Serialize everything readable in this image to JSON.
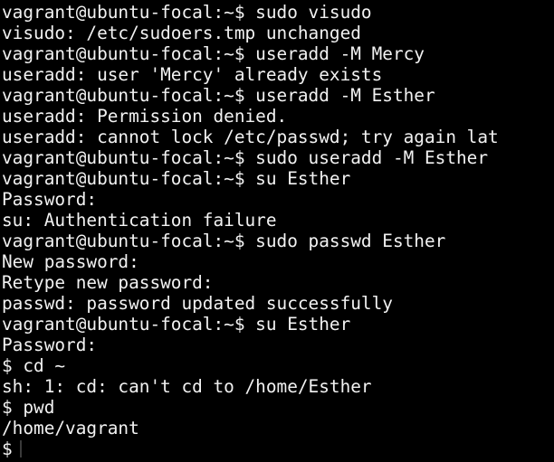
{
  "terminal": {
    "lines": [
      "vagrant@ubuntu-focal:~$ sudo visudo",
      "visudo: /etc/sudoers.tmp unchanged",
      "vagrant@ubuntu-focal:~$ useradd -M Mercy",
      "useradd: user 'Mercy' already exists",
      "vagrant@ubuntu-focal:~$ useradd -M Esther",
      "useradd: Permission denied.",
      "useradd: cannot lock /etc/passwd; try again lat",
      "vagrant@ubuntu-focal:~$ sudo useradd -M Esther",
      "vagrant@ubuntu-focal:~$ su Esther",
      "Password:",
      "su: Authentication failure",
      "vagrant@ubuntu-focal:~$ sudo passwd Esther",
      "New password:",
      "Retype new password:",
      "passwd: password updated successfully",
      "vagrant@ubuntu-focal:~$ su Esther",
      "Password:",
      "$ cd ~",
      "sh: 1: cd: can't cd to /home/Esther",
      "$ pwd",
      "/home/vagrant",
      "$"
    ],
    "colors": {
      "background": "#000000",
      "foreground": "#f2f2f2",
      "cursor": "#3a3a3a"
    }
  }
}
